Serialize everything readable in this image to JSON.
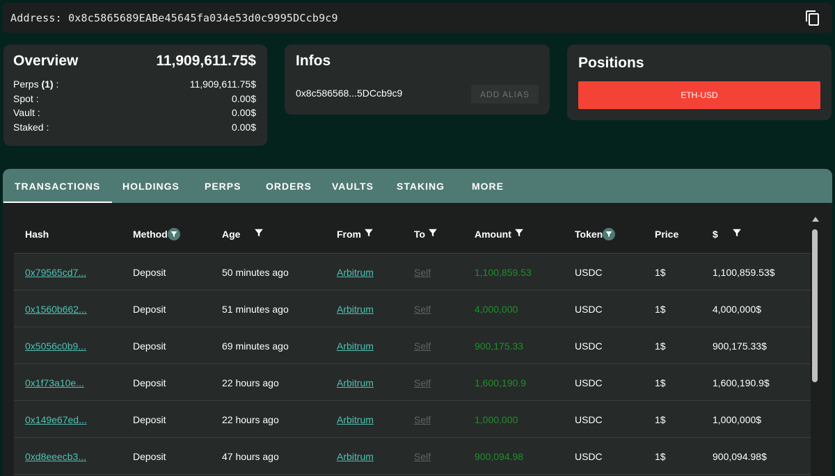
{
  "address": {
    "label": "Address: 0x8c5865689EABe45645fa034e53d0c9995DCcb9c9",
    "copy_icon": "copy-icon"
  },
  "overview": {
    "title": "Overview",
    "total": "11,909,611.75$",
    "rows": [
      {
        "label_prefix": "Perps ",
        "label_bold": "(1)",
        "label_suffix": " :",
        "value": "11,909,611.75$"
      },
      {
        "label_prefix": "Spot :",
        "label_bold": "",
        "label_suffix": "",
        "value": "0.00$"
      },
      {
        "label_prefix": "Vault :",
        "label_bold": "",
        "label_suffix": "",
        "value": "0.00$"
      },
      {
        "label_prefix": "Staked :",
        "label_bold": "",
        "label_suffix": "",
        "value": "0.00$"
      }
    ]
  },
  "infos": {
    "title": "Infos",
    "short_address": "0x8c586568...5DCcb9c9",
    "add_alias_label": "ADD ALIAS"
  },
  "positions": {
    "title": "Positions",
    "items": [
      "ETH-USD"
    ]
  },
  "tabs": [
    "TRANSACTIONS",
    "HOLDINGS",
    "PERPS",
    "ORDERS",
    "VAULTS",
    "STAKING",
    "MORE"
  ],
  "active_tab": "TRANSACTIONS",
  "table": {
    "headers": [
      "Hash",
      "Method",
      "Age",
      "From",
      "To",
      "Amount",
      "Token",
      "Price",
      "$"
    ],
    "rows": [
      {
        "hash": "0x79565cd7...",
        "method": "Deposit",
        "age": "50 minutes ago",
        "from": "Arbitrum",
        "to": "Self",
        "amount": "1,100,859.53",
        "token": "USDC",
        "price": "1$",
        "usd": "1,100,859.53$"
      },
      {
        "hash": "0x1560b662...",
        "method": "Deposit",
        "age": "51 minutes ago",
        "from": "Arbitrum",
        "to": "Self",
        "amount": "4,000,000",
        "token": "USDC",
        "price": "1$",
        "usd": "4,000,000$"
      },
      {
        "hash": "0x5056c0b9...",
        "method": "Deposit",
        "age": "69 minutes ago",
        "from": "Arbitrum",
        "to": "Self",
        "amount": "900,175.33",
        "token": "USDC",
        "price": "1$",
        "usd": "900,175.33$"
      },
      {
        "hash": "0x1f73a10e...",
        "method": "Deposit",
        "age": "22 hours ago",
        "from": "Arbitrum",
        "to": "Self",
        "amount": "1,600,190.9",
        "token": "USDC",
        "price": "1$",
        "usd": "1,600,190.9$"
      },
      {
        "hash": "0x149e67ed...",
        "method": "Deposit",
        "age": "22 hours ago",
        "from": "Arbitrum",
        "to": "Self",
        "amount": "1,000,000",
        "token": "USDC",
        "price": "1$",
        "usd": "1,000,000$"
      },
      {
        "hash": "0xd8eeecb3...",
        "method": "Deposit",
        "age": "47 hours ago",
        "from": "Arbitrum",
        "to": "Self",
        "amount": "900,094.98",
        "token": "USDC",
        "price": "1$",
        "usd": "900,094.98$"
      }
    ]
  },
  "colors": {
    "background": "#04231d",
    "card": "#262a29",
    "tab_bar": "#4f7a73",
    "link": "#4fc3b3",
    "amount": "#1f8f2a",
    "position_button": "#f44336"
  }
}
